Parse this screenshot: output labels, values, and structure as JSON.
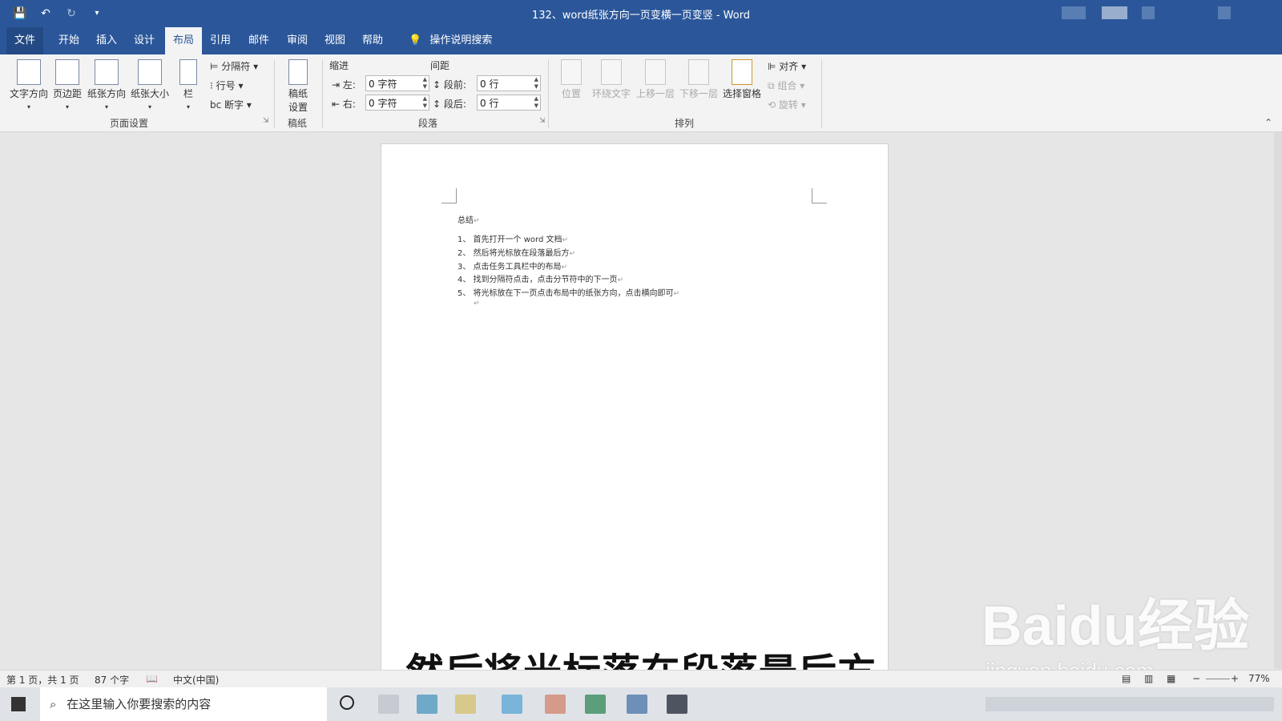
{
  "window": {
    "title": "132、word纸张方向一页变横一页变竖 - Word"
  },
  "tabs": [
    "文件",
    "开始",
    "插入",
    "设计",
    "布局",
    "引用",
    "邮件",
    "审阅",
    "视图",
    "帮助"
  ],
  "tell_me": "操作说明搜索",
  "ribbon": {
    "page_setup": {
      "text_direction": "文字方向",
      "margins": "页边距",
      "orientation": "纸张方向",
      "size": "纸张大小",
      "columns": "栏",
      "breaks": "分隔符",
      "line_numbers": "行号",
      "hyphenation": "断字",
      "label": "页面设置"
    },
    "manuscript": {
      "button": "稿纸设置",
      "label": "稿纸"
    },
    "paragraph": {
      "indent_title": "缩进",
      "spacing_title": "间距",
      "left_label": "左:",
      "left_value": "0 字符",
      "right_label": "右:",
      "right_value": "0 字符",
      "before_label": "段前:",
      "before_value": "0 行",
      "after_label": "段后:",
      "after_value": "0 行",
      "label": "段落"
    },
    "arrange": {
      "position": "位置",
      "wrap_text": "环绕文字",
      "bring_forward": "上移一层",
      "send_backward": "下移一层",
      "selection_pane": "选择窗格",
      "align": "对齐",
      "group": "组合",
      "rotate": "旋转",
      "label": "排列"
    }
  },
  "document": {
    "heading": "总结",
    "items": [
      "1、 首先打开一个 word 文档",
      "2、 然后将光标放在段落最后方",
      "3、 点击任务工具栏中的布局",
      "4、 找到分隔符点击，点击分节符中的下一页",
      "5、 将光标放在下一页点击布局中的纸张方向，点击横向即可"
    ]
  },
  "subtitle": "然后将光标落在段落最后方",
  "watermark": {
    "brand": "Baidu经验",
    "url": "jingyan.baidu.com"
  },
  "status": {
    "page": "第 1 页，共 1 页",
    "words": "87 个字",
    "language": "中文(中国)",
    "zoom": "77%"
  },
  "taskbar": {
    "search_placeholder": "在这里输入你要搜索的内容"
  }
}
